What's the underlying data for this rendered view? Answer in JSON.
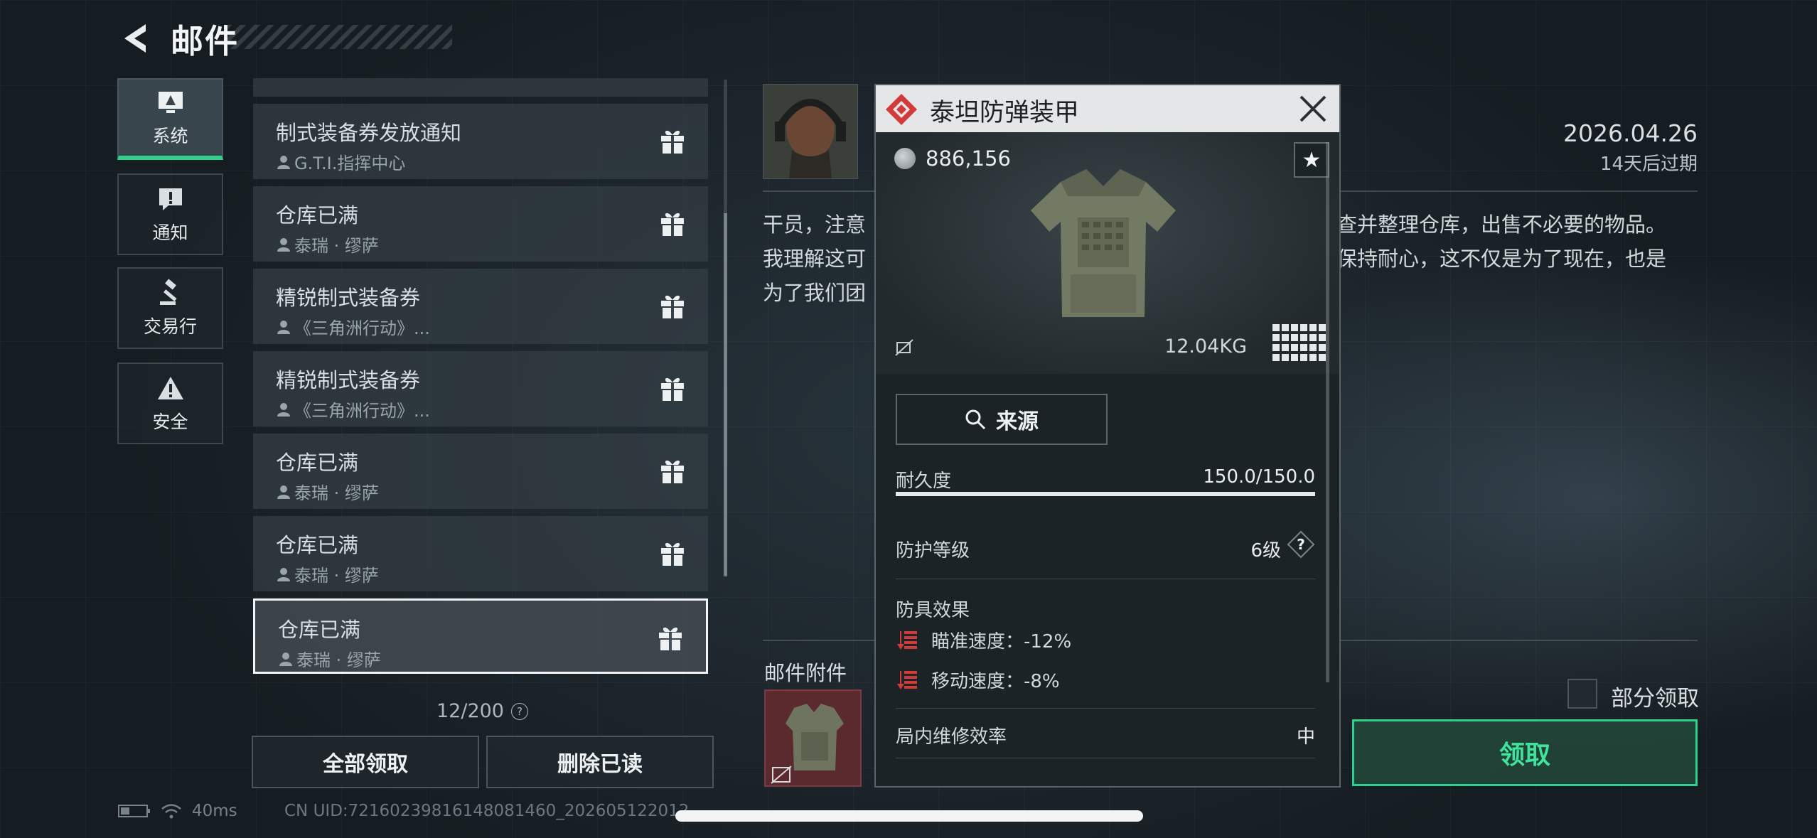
{
  "header": {
    "title": "邮件"
  },
  "categories": [
    {
      "label": "系统",
      "icon": "monitor-warning-icon",
      "active": true
    },
    {
      "label": "通知",
      "icon": "message-alert-icon",
      "active": false
    },
    {
      "label": "交易行",
      "icon": "gavel-icon",
      "active": false
    },
    {
      "label": "安全",
      "icon": "warning-triangle-icon",
      "active": false
    }
  ],
  "mails": [
    {
      "title": "制式装备券发放通知",
      "sender": "G.T.I.指挥中心"
    },
    {
      "title": "仓库已满",
      "sender": "泰瑞 · 缪萨"
    },
    {
      "title": "精锐制式装备券",
      "sender": "《三角洲行动》..."
    },
    {
      "title": "精锐制式装备券",
      "sender": "《三角洲行动》..."
    },
    {
      "title": "仓库已满",
      "sender": "泰瑞 · 缪萨"
    },
    {
      "title": "仓库已满",
      "sender": "泰瑞 · 缪萨"
    },
    {
      "title": "仓库已满",
      "sender": "泰瑞 · 缪萨",
      "selected": true
    }
  ],
  "mail_count": "12/200",
  "buttons": {
    "claim_all": "全部领取",
    "delete_read": "删除已读",
    "claim": "领取",
    "partial_claim": "部分领取"
  },
  "status": {
    "ping": "40ms",
    "uid": "CN UID:72160239816148081460_202605122012"
  },
  "mail_detail": {
    "date": "2026.04.26",
    "expire": "14天后过期",
    "body_lines": [
      "干员，注意",
      "我理解这可",
      "为了我们团"
    ],
    "body_right_lines": [
      "查并整理仓库，出售不必要的物品。",
      "保持耐心，这不仅是为了现在，也是",
      ""
    ],
    "attachments_label": "邮件附件"
  },
  "item_popup": {
    "name": "泰坦防弹装甲",
    "price": "886,156",
    "weight": "12.04KG",
    "source_label": "来源",
    "durability_label": "耐久度",
    "durability_value": "150.0/150.0",
    "durability_fraction": 1.0,
    "protection_label": "防护等级",
    "protection_value": "6级",
    "effects_label": "防具效果",
    "effects": [
      {
        "text": "瞄准速度：-12%"
      },
      {
        "text": "移动速度：-8%"
      }
    ],
    "repair_label": "局内维修效率",
    "repair_value": "中",
    "colors": {
      "badge": "#d33a3a",
      "accent": "#2fd08a"
    }
  }
}
